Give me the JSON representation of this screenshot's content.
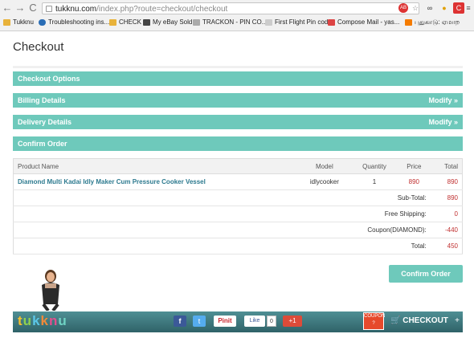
{
  "browser": {
    "url_host": "tukknu.com",
    "url_path": "/index.php?route=checkout/checkout",
    "bookmarks": [
      "Tukknu",
      "Troubleshooting ins...",
      "CHECK",
      "My eBay Sold",
      "TRACKON - PIN CO...",
      "First Flight Pin code",
      "Compose Mail - yas...",
      "புதுகாடு: ஏமாற"
    ]
  },
  "page": {
    "title": "Checkout",
    "panels": [
      {
        "label": "Checkout Options",
        "modify": ""
      },
      {
        "label": "Billing Details",
        "modify": "Modify »"
      },
      {
        "label": "Delivery Details",
        "modify": "Modify »"
      },
      {
        "label": "Confirm Order",
        "modify": ""
      }
    ],
    "table": {
      "headers": {
        "product": "Product Name",
        "model": "Model",
        "quantity": "Quantity",
        "price": "Price",
        "total": "Total"
      },
      "item": {
        "name": "Diamond Multi Kadai Idly Maker Cum Pressure Cooker Vessel",
        "model": "idlycooker",
        "quantity": "1",
        "price": "890",
        "total": "890"
      },
      "totals": [
        {
          "label": "Sub-Total:",
          "value": "890"
        },
        {
          "label": "Free Shipping:",
          "value": "0"
        },
        {
          "label": "Coupon(DIAMOND):",
          "value": "-440"
        },
        {
          "label": "Total:",
          "value": "450"
        }
      ]
    },
    "confirm_button": "Confirm Order"
  },
  "footer": {
    "logo_letters": [
      "t",
      "u",
      "k",
      "k",
      "n",
      "u"
    ],
    "pinit": "Pinit",
    "like": "Like",
    "like_count": "0",
    "gplus": "+1",
    "coupon": "COUPON",
    "checkout": "CHECKOUT",
    "plus": "+"
  },
  "colors": {
    "accent": "#6ec9bb",
    "price_red": "#c03030",
    "product_blue": "#2d7a8f"
  }
}
